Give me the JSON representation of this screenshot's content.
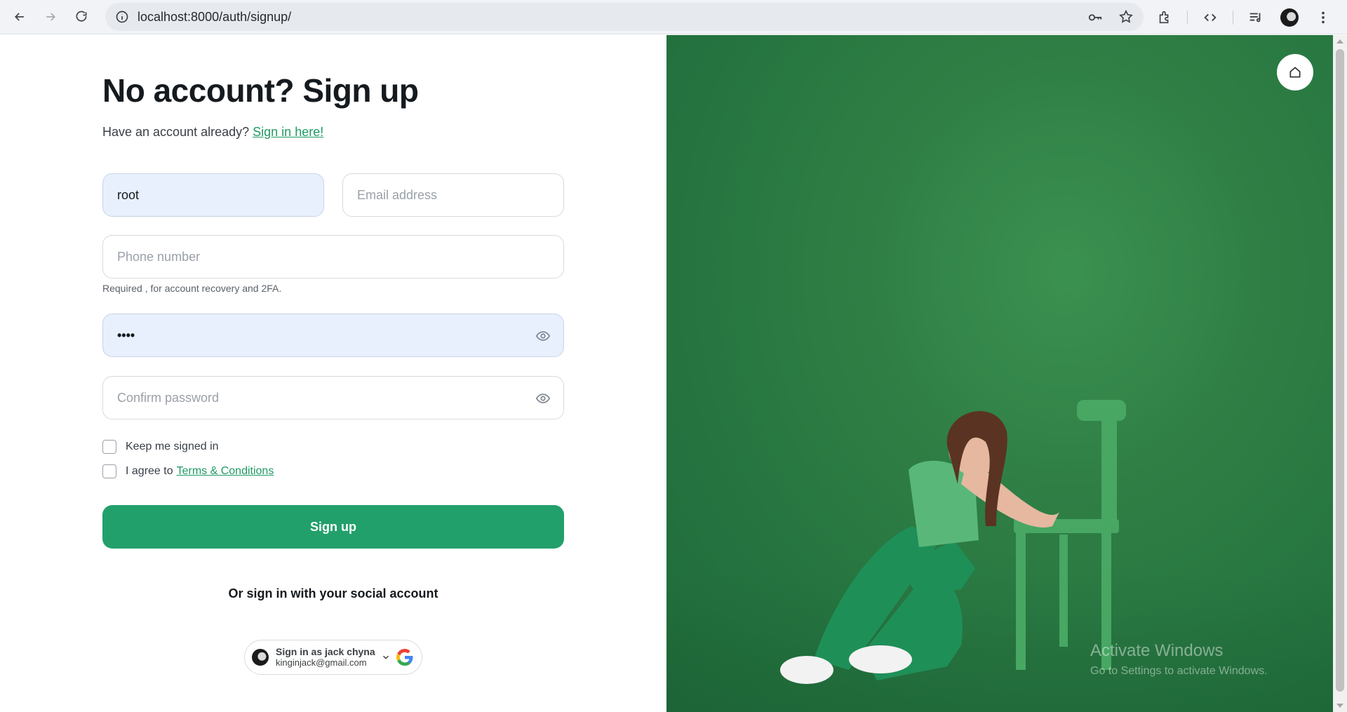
{
  "browser": {
    "url": "localhost:8000/auth/signup/"
  },
  "form": {
    "title": "No account? Sign up",
    "subtitle_prefix": "Have an account already?",
    "signin_link": "Sign in here!",
    "username": {
      "value": "root"
    },
    "email": {
      "placeholder": "Email address"
    },
    "phone": {
      "placeholder": "Phone number",
      "hint": "Required , for account recovery and 2FA."
    },
    "password": {
      "value": "••••"
    },
    "confirm_password": {
      "placeholder": "Confirm password"
    },
    "keep_signed_in": "Keep me signed in",
    "agree_prefix": "I agree to",
    "terms_link": "Terms & Conditions",
    "submit": "Sign up",
    "social_text": "Or sign in with your social account",
    "google": {
      "name": "Sign in as jack chyna",
      "email": "kinginjack@gmail.com"
    }
  },
  "overlay": {
    "activate_title": "Activate Windows",
    "activate_sub": "Go to Settings to activate Windows."
  },
  "colors": {
    "accent": "#22a06b",
    "link": "#1f9a63",
    "panel_green": "#2f7f45",
    "autofill": "#e8f0fe"
  },
  "icons": [
    "back-icon",
    "forward-icon",
    "reload-icon",
    "info-icon",
    "key-icon",
    "star-icon",
    "extensions-icon",
    "code-icon",
    "media-icon",
    "menu-icon",
    "eye-icon",
    "home-icon",
    "google-icon",
    "chevron-down-icon"
  ]
}
